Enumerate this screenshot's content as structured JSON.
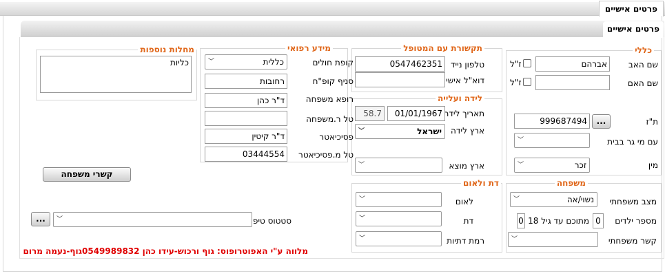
{
  "tab": {
    "title": "פרטים אישיים"
  },
  "section": {
    "title": "פרטים אישיים"
  },
  "general": {
    "title": "כללי",
    "father_label": "שם האב",
    "father_value": "אברהם",
    "mother_label": "שם האם",
    "mother_value": "",
    "deceased_label": "ז\"ל",
    "id_label": "ת\"ז",
    "id_value": "999687494",
    "id_button": "...",
    "lives_with_label": "עם מי גר בבית",
    "lives_with_value": "",
    "gender_label": "מין",
    "gender_value": "זכר"
  },
  "contact": {
    "title": "תקשורת עם המטופל",
    "mobile_label": "טלפון נייד",
    "mobile_value": "0547462351",
    "email_label": "דוא\"ל אישי",
    "email_value": ""
  },
  "birth": {
    "title": "לידה ועלייה",
    "birthdate_label": "תאריך לידה",
    "birthdate_value": "01/01/1967",
    "age_value": "58.7",
    "birth_country_label": "ארץ לידה",
    "birth_country_value": "ישראל",
    "origin_label": "ארץ מוצא",
    "origin_value": ""
  },
  "medical": {
    "title": "מידע רפואי",
    "hmo_label": "קופת חולים",
    "hmo_value": "כללית",
    "branch_label": "סניף קופ\"ח",
    "branch_value": "רחובות",
    "doctor_label": "רופא משפחה",
    "doctor_value": "ד\"ר כהן",
    "doctor_phone_label": "טל ר.משפחה",
    "doctor_phone_value": "",
    "psychiatrist_label": "פסיכיאטר",
    "psychiatrist_value": "ד\"ר קיטין",
    "psych_phone_label": "טל מ.פסיכיאטר",
    "psych_phone_value": "03444554"
  },
  "diseases": {
    "title": "מחלות נוספות",
    "value": "כליות"
  },
  "family": {
    "title": "משפחה",
    "marital_label": "מצב משפחתי",
    "marital_value": "נשוי/אה",
    "children_label": "מספר ילדים",
    "children_value": "0",
    "under18_label": "מתוכם עד גיל 18",
    "under18_value": "0",
    "relation_label": "קשר משפחתי",
    "relation_value": ""
  },
  "religion": {
    "title": "דת ולאום",
    "nationality_label": "לאום",
    "nationality_value": "",
    "religion_label": "דת",
    "religion_value": "",
    "level_label": "רמת דתיות",
    "level_value": ""
  },
  "family_links_button": "קשרי משפחה",
  "status": {
    "label": "סטטוס טיפולי",
    "value": "",
    "button": "..."
  },
  "footer_note": "מלווה ע\"י האפוטרופוס: גוף ורכוש-עידו כהן 0549989832גוף-נעמה מרום",
  "colors": {
    "accent": "#e0671a",
    "warning": "#e00000"
  }
}
